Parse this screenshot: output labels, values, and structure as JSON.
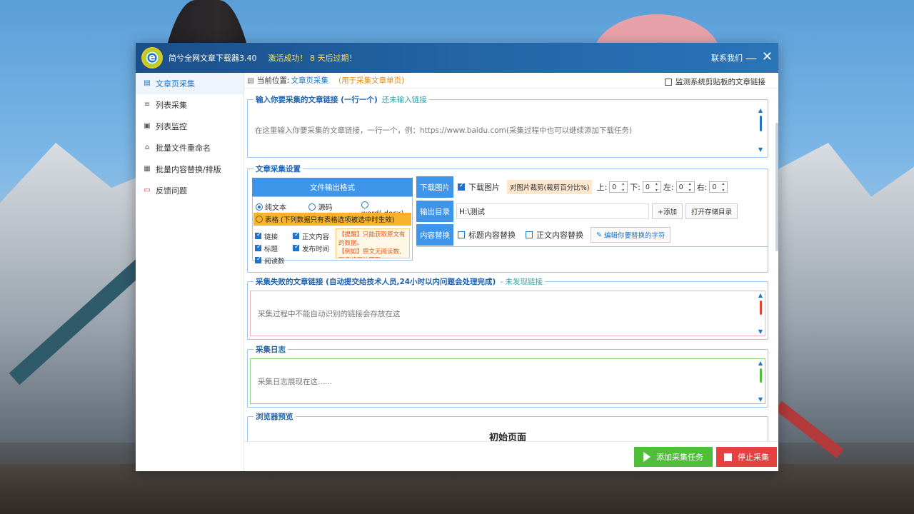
{
  "app": {
    "title": "简兮全网文章下载器3.40",
    "activation": "激活成功！ 8 天后过期！",
    "logo_letter": "e",
    "contact": "联系我们"
  },
  "sidebar": {
    "items": [
      {
        "label": "文章页采集",
        "icon": "document-icon"
      },
      {
        "label": "列表采集",
        "icon": "list-search-icon"
      },
      {
        "label": "列表监控",
        "icon": "monitor-icon"
      },
      {
        "label": "批量文件重命名",
        "icon": "rename-icon"
      },
      {
        "label": "批量内容替换/排版",
        "icon": "replace-icon"
      },
      {
        "label": "反馈问题",
        "icon": "feedback-icon"
      }
    ]
  },
  "breadcrumb": {
    "label": "当前位置:",
    "value": "文章页采集",
    "hint": "(用于采集文章单页)",
    "monitor_label": "监测系统剪贴板的文章链接"
  },
  "input_group": {
    "title": "输入你要采集的文章链接 (一行一个)",
    "status": "还未输入链接",
    "placeholder": "在这里输入你要采集的文章链接，一行一个，例：https://www.baidu.com(采集过程中也可以继续添加下载任务)"
  },
  "settings": {
    "title": "文章采集设置",
    "format_header": "文件输出格式",
    "formats": [
      "纯文本(.txt)",
      "源码(.html)",
      "word(.docx)"
    ],
    "table_label": "表格 (下列数据只有表格选项被选中时生效)",
    "fields": [
      "链接",
      "正文内容",
      "标题",
      "发布时间",
      "阅读数"
    ],
    "tip_1": "【提醒】只能获取原文有的数据。",
    "tip_2": "【例如】原文无阅读数,程序将无法获取.",
    "download_label": "下载图片",
    "download_checkbox": "下载图片",
    "crop_label": "对图片裁剪(裁剪百分比%)",
    "crop": [
      {
        "label": "上:",
        "value": "0"
      },
      {
        "label": "下:",
        "value": "0"
      },
      {
        "label": "左:",
        "value": "0"
      },
      {
        "label": "右:",
        "value": "0"
      }
    ],
    "output_label": "输出目录",
    "output_path": "H:\\测试",
    "add_button": "+添加",
    "open_button": "打开存储目录",
    "replace_label": "内容替换",
    "replace_title": "标题内容替换",
    "replace_body": "正文内容替换",
    "edit_button": "编辑你要替换的字符"
  },
  "failed_group": {
    "title": "采集失败的文章链接 (自动提交给技术人员,24小时以内问题会处理完成)",
    "status": "- 未发现链接",
    "placeholder": "采集过程中不能自动识别的链接会存放在这"
  },
  "log_group": {
    "title": "采集日志",
    "placeholder": "采集日志展现在这......"
  },
  "preview_group": {
    "title": "浏览器预览",
    "page_title": "初始页面"
  },
  "actions": {
    "add_task": "添加采集任务",
    "stop": "停止采集"
  },
  "colors": {
    "accent": "#3f95ea",
    "title_bar": "#2366a8",
    "activation": "#ffe14d",
    "go": "#4fbf3a",
    "stop": "#e64141",
    "table_bar": "#f7b32b"
  }
}
